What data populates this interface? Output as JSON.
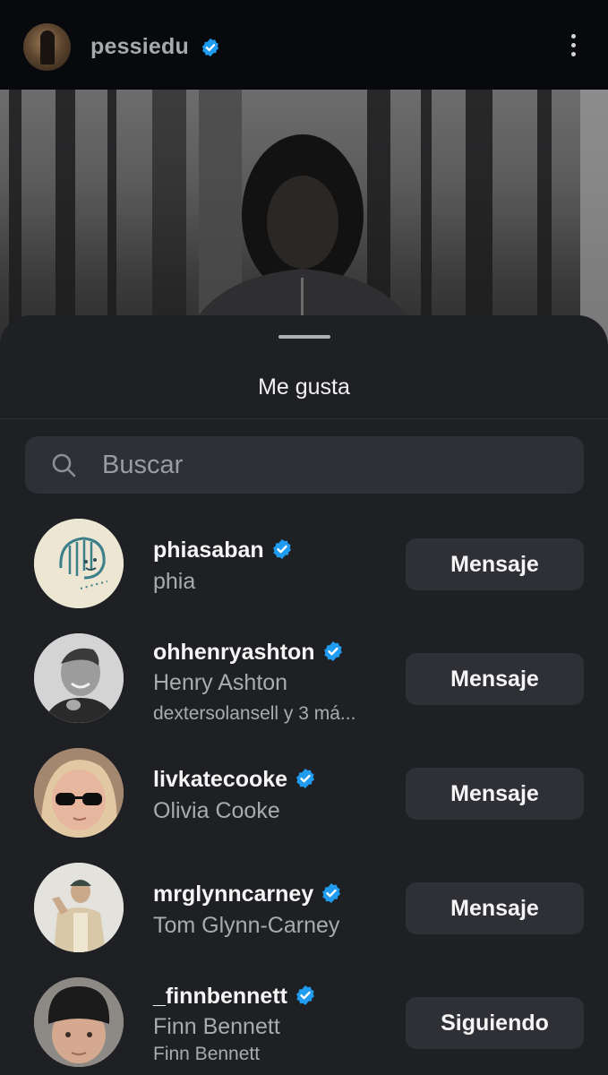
{
  "post": {
    "username": "pessiedu"
  },
  "sheet": {
    "title": "Me gusta",
    "search_placeholder": "Buscar"
  },
  "likes": [
    {
      "username": "phiasaban",
      "full_name": "phia",
      "subtitle": "",
      "action": "Mensaje",
      "verified": true
    },
    {
      "username": "ohhenryashton",
      "full_name": "Henry Ashton",
      "subtitle": "dextersolansell y 3 má...",
      "action": "Mensaje",
      "verified": true
    },
    {
      "username": "livkatecooke",
      "full_name": "Olivia Cooke",
      "subtitle": "",
      "action": "Mensaje",
      "verified": true
    },
    {
      "username": "mrglynncarney",
      "full_name": "Tom Glynn-Carney",
      "subtitle": "",
      "action": "Mensaje",
      "verified": true
    },
    {
      "username": "_finnbennett",
      "full_name": "Finn Bennett",
      "subtitle": "Finn Bennett",
      "action": "Siguiendo",
      "verified": true
    }
  ],
  "colors": {
    "verified": "#1f9bf0",
    "sheet_bg": "#1f2024",
    "button_bg": "#2e3036"
  }
}
